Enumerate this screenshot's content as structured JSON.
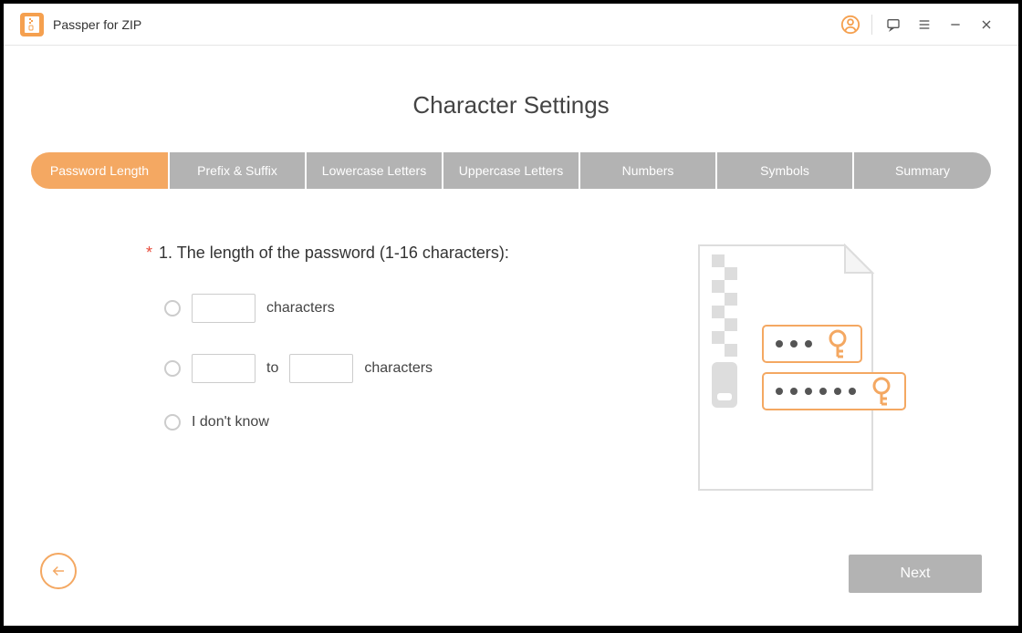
{
  "app": {
    "title": "Passper for ZIP"
  },
  "page": {
    "title": "Character Settings"
  },
  "tabs": [
    {
      "label": "Password Length",
      "active": true
    },
    {
      "label": "Prefix & Suffix",
      "active": false
    },
    {
      "label": "Lowercase Letters",
      "active": false
    },
    {
      "label": "Uppercase Letters",
      "active": false
    },
    {
      "label": "Numbers",
      "active": false
    },
    {
      "label": "Symbols",
      "active": false
    },
    {
      "label": "Summary",
      "active": false
    }
  ],
  "question": {
    "required_mark": "*",
    "text": "1. The length of the password (1-16 characters):"
  },
  "options": {
    "exact_suffix": "characters",
    "range_mid": "to",
    "range_suffix": "characters",
    "unknown_label": "I don't know"
  },
  "buttons": {
    "next": "Next"
  },
  "colors": {
    "accent": "#f4a862",
    "tab_inactive": "#b3b3b3"
  }
}
